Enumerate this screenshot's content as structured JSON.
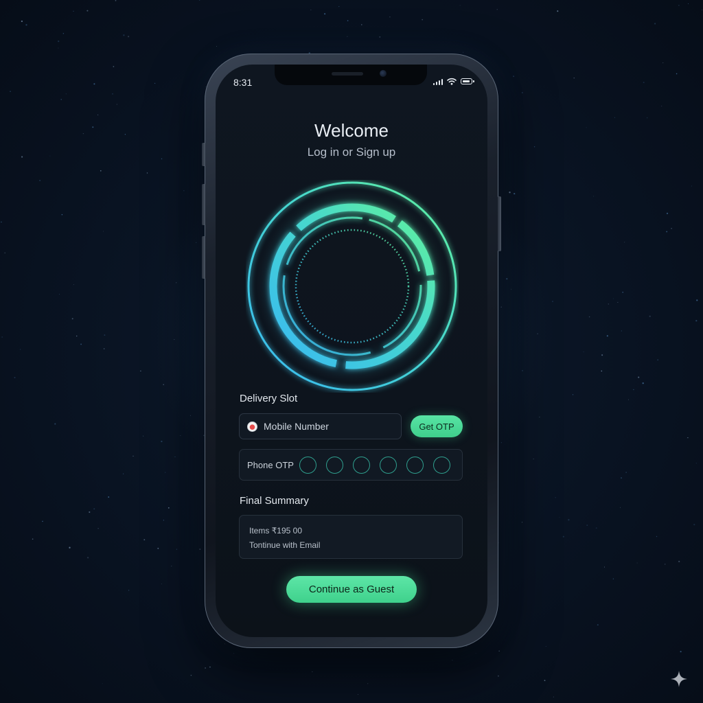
{
  "status_bar": {
    "time": "8:31",
    "icons": [
      "cellular-signal-icon",
      "wifi-icon",
      "battery-icon"
    ]
  },
  "header": {
    "title": "Welcome",
    "subtitle": "Log in or Sign up"
  },
  "hero": {
    "icon": "glowing-ring-icon",
    "gradient_colors": [
      "#3ec8f0",
      "#5cf0a0"
    ]
  },
  "delivery": {
    "label": "Delivery Slot",
    "mobile_placeholder": "Mobile Number",
    "country_icon": "country-flag-icon",
    "get_otp_label": "Get OTP"
  },
  "otp": {
    "label": "Phone OTP",
    "digits": [
      "",
      "",
      "",
      "",
      "",
      ""
    ]
  },
  "summary": {
    "label": "Final Summary",
    "items_line": "Items ₹195 00",
    "email_line": "Tontinue with Email"
  },
  "cta": {
    "guest_label": "Continue as Guest"
  },
  "colors": {
    "accent_green": "#4cdb97",
    "accent_cyan": "#3ec8f0",
    "background": "#0b1420",
    "screen": "#0e151e"
  },
  "watermark": {
    "icon": "sparkle-icon"
  }
}
